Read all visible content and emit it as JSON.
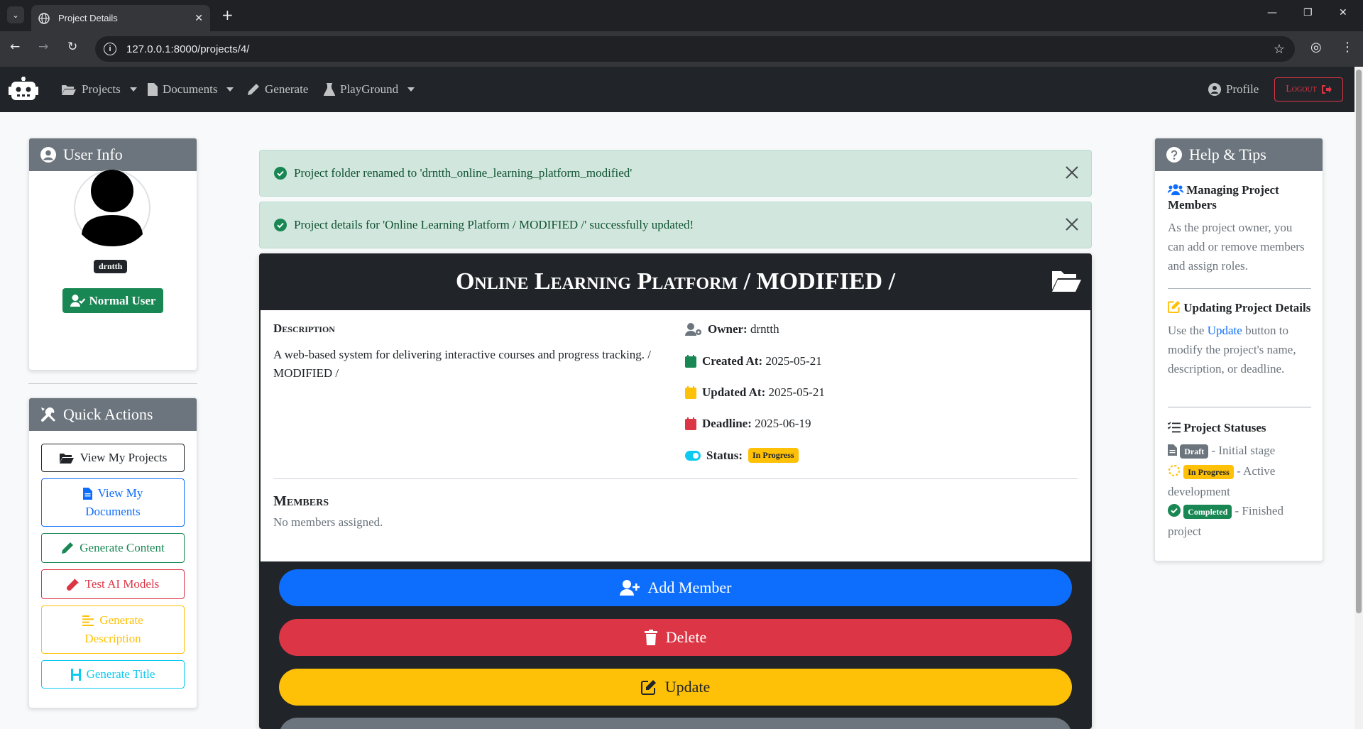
{
  "browser": {
    "tab_title": "Project Details",
    "url": "127.0.0.1:8000/projects/4/"
  },
  "navbar": {
    "projects": "Projects",
    "documents": "Documents",
    "generate": "Generate",
    "playground": "PlayGround",
    "profile": "Profile",
    "logout": "Logout"
  },
  "user_info": {
    "title": "User Info",
    "username": "drntth",
    "user_type": "Normal User"
  },
  "quick_actions": {
    "title": "Quick Actions",
    "view_projects": "View My Projects",
    "view_documents_1": "View My",
    "view_documents_2": "Documents",
    "generate_content": "Generate Content",
    "test_ai": "Test AI Models",
    "generate_description_1": "Generate",
    "generate_description_2": "Description",
    "generate_title": "Generate Title"
  },
  "alerts": [
    {
      "text": "Project folder renamed to 'drntth_online_learning_platform_modified'"
    },
    {
      "text": "Project details for 'Online Learning Platform / MODIFIED /' successfully updated!"
    }
  ],
  "project": {
    "title": "Online Learning Platform / MODIFIED /",
    "description_label": "Description",
    "description": "A web-based system for delivering interactive courses and progress tracking. / MODIFIED /",
    "owner_label": "Owner:",
    "owner": "drntth",
    "created_label": "Created At:",
    "created": "2025-05-21",
    "updated_label": "Updated At:",
    "updated": "2025-05-21",
    "deadline_label": "Deadline:",
    "deadline": "2025-06-19",
    "status_label": "Status:",
    "status": "In Progress",
    "members_label": "Members",
    "members_empty": "No members assigned.",
    "add_member": "Add Member",
    "delete": "Delete",
    "update": "Update"
  },
  "help": {
    "title": "Help & Tips",
    "members_title": "Managing Project Members",
    "members_text": "As the project owner, you can add or remove members and assign roles.",
    "updating_title": "Updating Project Details",
    "updating_pre": "Use the ",
    "updating_link": "Update",
    "updating_post": " button to modify the project's name, description, or deadline.",
    "statuses_title": "Project Statuses",
    "draft": "Draft",
    "draft_desc": " - Initial stage",
    "in_progress": "In Progress",
    "in_progress_desc": " - Active development",
    "completed": "Completed",
    "completed_desc": " - Finished project"
  },
  "colors": {
    "primary": "#0d6efd",
    "danger": "#dc3545",
    "warning": "#ffc107",
    "success": "#198754",
    "info": "#0dcaf0",
    "dark": "#212529",
    "secondary": "#6c757d"
  }
}
